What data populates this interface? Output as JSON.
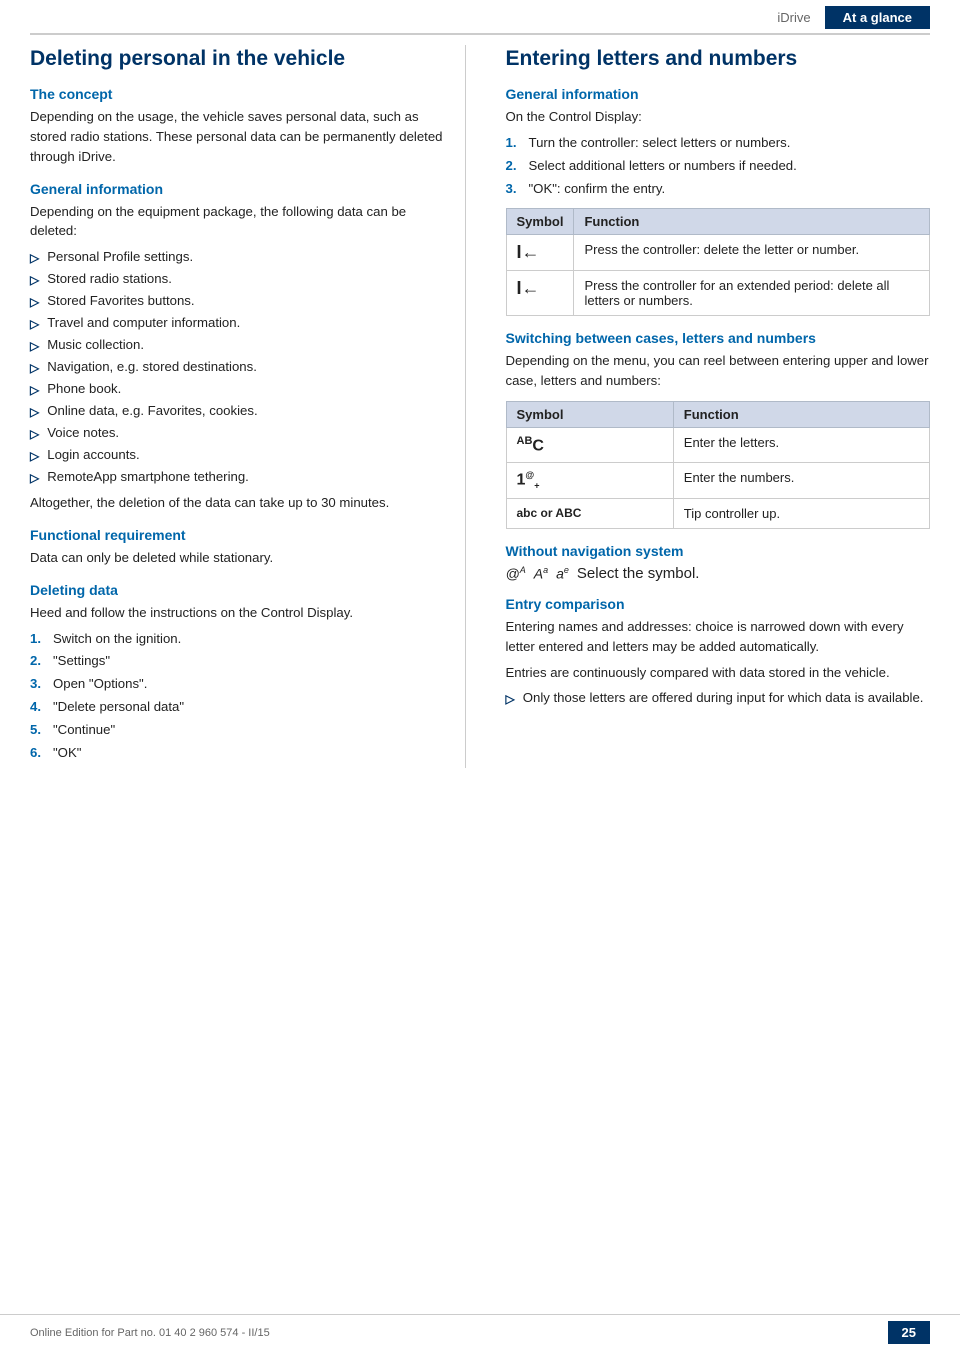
{
  "header": {
    "idrive_label": "iDrive",
    "ataglance_label": "At a glance"
  },
  "left_section": {
    "title": "Deleting personal in the vehicle",
    "the_concept": {
      "subtitle": "The concept",
      "body": "Depending on the usage, the vehicle saves personal data, such as stored radio stations. These personal data can be permanently deleted through iDrive."
    },
    "general_information": {
      "subtitle": "General information",
      "intro": "Depending on the equipment package, the following data can be deleted:",
      "bullets": [
        "Personal Profile settings.",
        "Stored radio stations.",
        "Stored Favorites buttons.",
        "Travel and computer information.",
        "Music collection.",
        "Navigation, e.g. stored destinations.",
        "Phone book.",
        "Online data, e.g. Favorites, cookies.",
        "Voice notes.",
        "Login accounts.",
        "RemoteApp smartphone tethering."
      ],
      "outro": "Altogether, the deletion of the data can take up to 30 minutes."
    },
    "functional_requirement": {
      "subtitle": "Functional requirement",
      "body": "Data can only be deleted while stationary."
    },
    "deleting_data": {
      "subtitle": "Deleting data",
      "intro": "Heed and follow the instructions on the Control Display.",
      "steps": [
        "Switch on the ignition.",
        "\"Settings\"",
        "Open \"Options\".",
        "\"Delete personal data\"",
        "\"Continue\"",
        "\"OK\""
      ]
    }
  },
  "right_section": {
    "title": "Entering letters and numbers",
    "general_information": {
      "subtitle": "General information",
      "intro": "On the Control Display:",
      "steps": [
        "Turn the controller: select letters or numbers.",
        "Select additional letters or numbers if needed.",
        "\"OK\": confirm the entry."
      ],
      "table": {
        "headers": [
          "Symbol",
          "Function"
        ],
        "rows": [
          {
            "symbol": "I←",
            "function": "Press the controller: delete the letter or number."
          },
          {
            "symbol": "I←",
            "function": "Press the controller for an extended period: delete all letters or numbers."
          }
        ]
      }
    },
    "switching": {
      "subtitle": "Switching between cases, letters and numbers",
      "body": "Depending on the menu, you can reel between entering upper and lower case, letters and numbers:",
      "table": {
        "headers": [
          "Symbol",
          "Function"
        ],
        "rows": [
          {
            "symbol": "ᴬᴮC",
            "function": "Enter the letters."
          },
          {
            "symbol": "1@+",
            "function": "Enter the numbers."
          },
          {
            "symbol": "abc or ABC",
            "function": "Tip controller up."
          }
        ]
      }
    },
    "without_nav": {
      "subtitle": "Without navigation system",
      "symbols": [
        "@ᴬ",
        "Aᵃ",
        "aᵉ"
      ],
      "text": "Select the symbol."
    },
    "entry_comparison": {
      "subtitle": "Entry comparison",
      "body1": "Entering names and addresses: choice is narrowed down with every letter entered and letters may be added automatically.",
      "body2": "Entries are continuously compared with data stored in the vehicle.",
      "bullet": "Only those letters are offered during input for which data is available."
    }
  },
  "footer": {
    "text": "Online Edition for Part no. 01 40 2 960 574 - II/15",
    "page": "25"
  }
}
